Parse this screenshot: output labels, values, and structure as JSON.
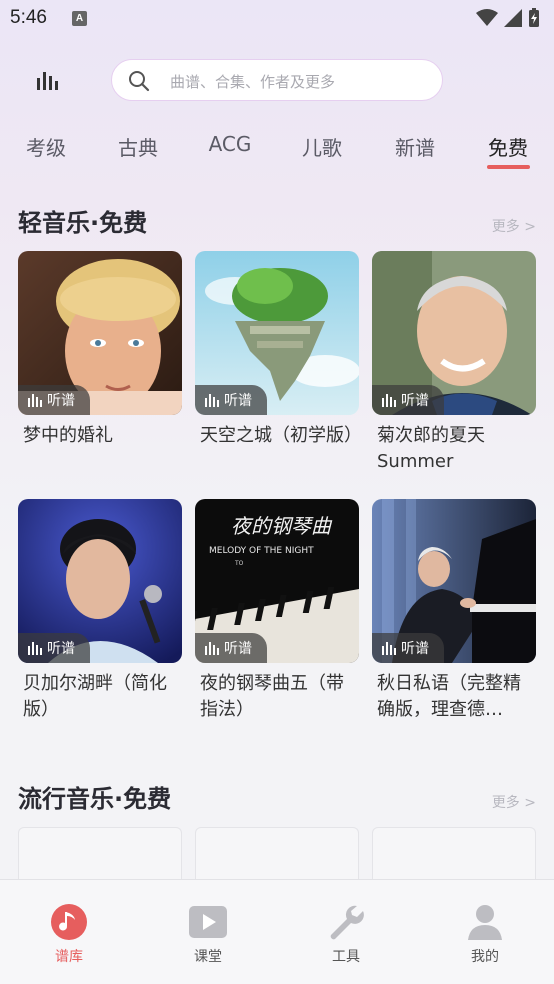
{
  "status": {
    "time": "5:46",
    "notif_letter": "A"
  },
  "search": {
    "placeholder": "曲谱、合集、作者及更多"
  },
  "tabs": [
    {
      "label": "考级"
    },
    {
      "label": "古典"
    },
    {
      "label": "ACG"
    },
    {
      "label": "儿歌"
    },
    {
      "label": "新谱"
    },
    {
      "label": "免费",
      "active": true
    }
  ],
  "sections": [
    {
      "title": "轻音乐·免费",
      "more": "更多 >",
      "items": [
        {
          "title": "梦中的婚礼",
          "badge": "听谱"
        },
        {
          "title": "天空之城（初学版）",
          "badge": "听谱"
        },
        {
          "title": "菊次郎的夏天Summer",
          "badge": "听谱"
        },
        {
          "title": "贝加尔湖畔（简化版）",
          "badge": "听谱"
        },
        {
          "title": "夜的钢琴曲五（带指法）",
          "badge": "听谱"
        },
        {
          "title": "秋日私语（完整精确版，理查德…",
          "badge": "听谱"
        }
      ]
    },
    {
      "title": "流行音乐·免费",
      "more": "更多 >"
    }
  ],
  "cover_text": {
    "night_title": "夜的钢琴曲",
    "night_subtitle": "MELODY OF THE NIGHT",
    "night_small": "TO"
  },
  "bottom_nav": [
    {
      "label": "谱库",
      "icon": "music-note-icon",
      "active": true
    },
    {
      "label": "课堂",
      "icon": "play-video-icon"
    },
    {
      "label": "工具",
      "icon": "wrench-icon"
    },
    {
      "label": "我的",
      "icon": "person-icon"
    }
  ],
  "colors": {
    "accent": "#e65e5e",
    "search_border": "#e6cff0"
  }
}
